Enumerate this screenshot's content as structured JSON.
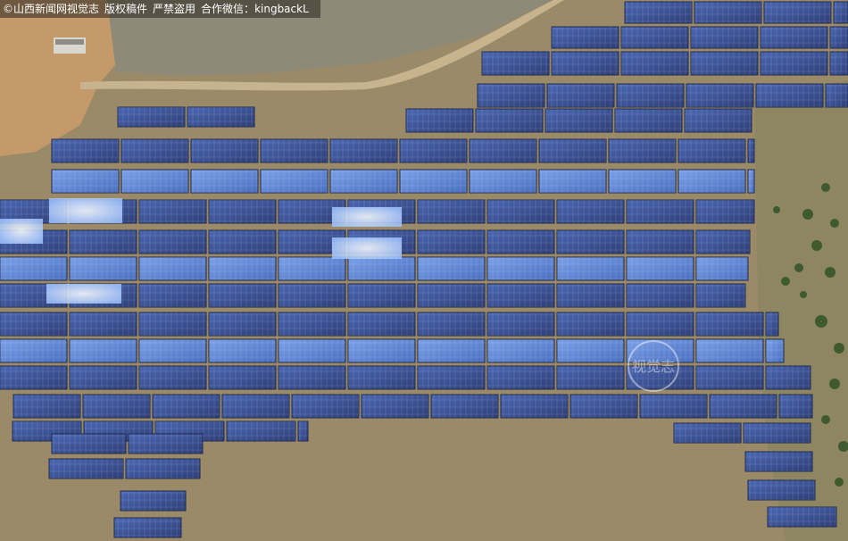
{
  "photo": {
    "description_alt": "",
    "caption": {
      "copyright_symbol": "©",
      "source": "山西新闻网视觉志",
      "rights": "版权稿件",
      "prohibition": "严禁盗用",
      "contact_label": "合作微信：",
      "contact_id": "kingbackL"
    },
    "watermark_text": "视觉志"
  },
  "colors": {
    "ground": "#9a8a68",
    "ground_light": "#b8a57e",
    "ground_warm": "#c49a6a",
    "panel": "#3b4f8c",
    "panel_light": "#5b7fcf",
    "panel_glare": "#e6f2ff",
    "road": "#c7b48e",
    "vegetation": "#3f5a2e"
  }
}
